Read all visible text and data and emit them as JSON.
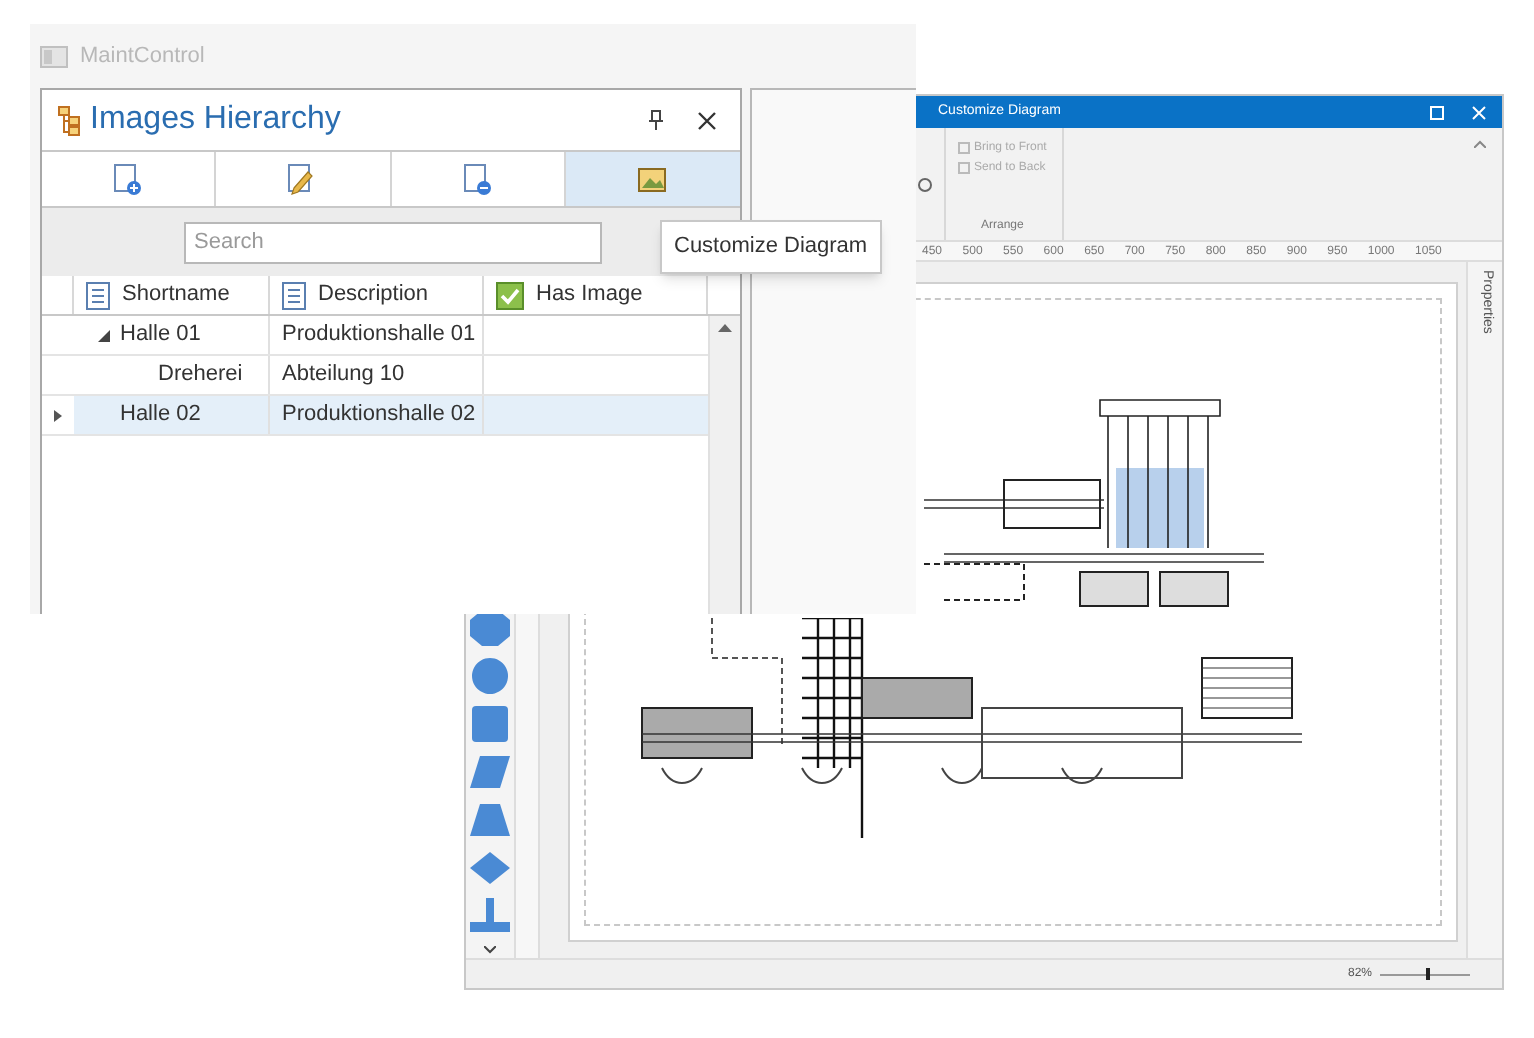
{
  "background_window": {
    "title": "MaintControl"
  },
  "panel": {
    "title": "Images Hierarchy",
    "toolbar": [
      {
        "kind": "add",
        "selected": false
      },
      {
        "kind": "edit",
        "selected": false
      },
      {
        "kind": "remove",
        "selected": false
      },
      {
        "kind": "image",
        "selected": true
      }
    ],
    "search": {
      "placeholder": "Search"
    },
    "tooltip": "Customize Diagram",
    "columns": [
      {
        "label": "Shortname",
        "kind": "text"
      },
      {
        "label": "Description",
        "kind": "text"
      },
      {
        "label": "Has Image",
        "kind": "check"
      }
    ],
    "rows": [
      {
        "shortname": "Halle 01",
        "description": "Produktionshalle 01",
        "selected": false,
        "expanded": true,
        "children": [
          {
            "shortname": "Dreherei",
            "description": "Abteilung 10",
            "selected": false
          }
        ]
      },
      {
        "shortname": "Halle 02",
        "description": "Produktionshalle 02",
        "selected": true
      }
    ]
  },
  "diagram_window": {
    "title": "Customize Diagram",
    "ribbon": {
      "buttons": [
        "Bring to Front",
        "Send to Back"
      ],
      "group": "Arrange"
    },
    "ruler": [
      "450",
      "500",
      "550",
      "600",
      "650",
      "700",
      "750",
      "800",
      "850",
      "900",
      "950",
      "1000",
      "1050"
    ],
    "side_panel": "Properties",
    "zoom": {
      "reading": "82%",
      "level": 0.5
    }
  }
}
